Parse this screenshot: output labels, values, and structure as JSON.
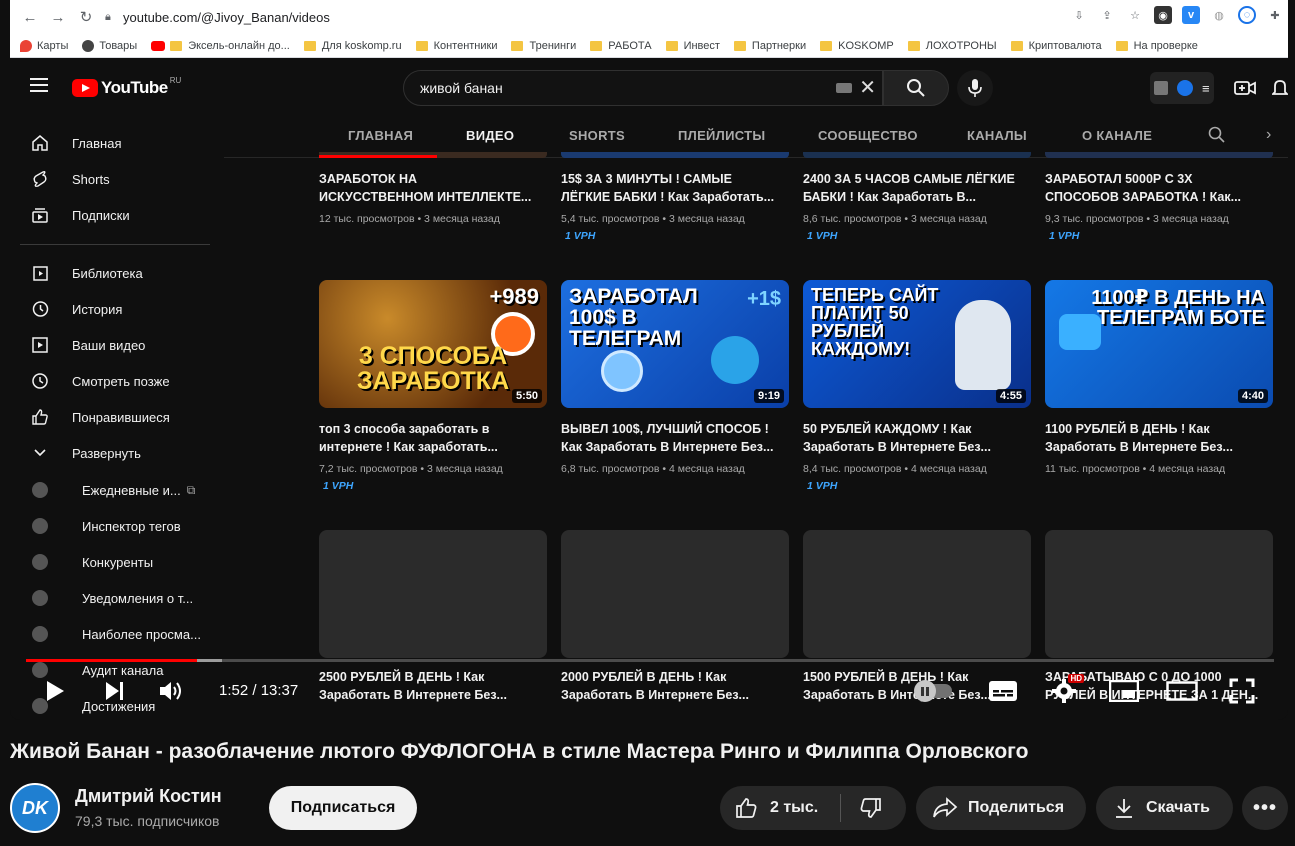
{
  "browser": {
    "url": "youtube.com/@Jivoy_Banan/videos",
    "bookmarks": [
      "Карты",
      "Товары",
      "Эксель-онлайн до...",
      "Для koskomp.ru",
      "Контентники",
      "Тренинги",
      "РАБОТА",
      "Инвест",
      "Партнерки",
      "KOSKOMP",
      "ЛОХОТРОНЫ",
      "Криптовалюта",
      "На проверке"
    ]
  },
  "yt_inner": {
    "logo_text": "YouTube",
    "logo_region": "RU",
    "search_query": "живой банан",
    "tabs": [
      "ГЛАВНАЯ",
      "ВИДЕО",
      "SHORTS",
      "ПЛЕЙЛИСТЫ",
      "СООБЩЕСТВО",
      "КАНАЛЫ",
      "О КАНАЛЕ"
    ],
    "active_tab": "ВИДЕО",
    "sidebar": {
      "main": [
        "Главная",
        "Shorts",
        "Подписки"
      ],
      "library": [
        "Библиотека",
        "История",
        "Ваши видео",
        "Смотреть позже",
        "Понравившиеся",
        "Развернуть"
      ],
      "extensions": [
        "Ежедневные и...",
        "Инспектор тегов",
        "Конкуренты",
        "Уведомления о т...",
        "Наиболее просма...",
        "Аудит канала",
        "Достижения"
      ]
    },
    "row1": [
      {
        "title1": "ЗАРАБОТОК НА",
        "title2": "ИСКУССТВЕННОМ ИНТЕЛЛЕКТЕ...",
        "meta": "12 тыс. просмотров • 3 месяца назад",
        "vph": ""
      },
      {
        "title1": "15$ ЗА 3 МИНУТЫ ! САМЫЕ",
        "title2": "ЛЁГКИЕ БАБКИ ! Как Заработать...",
        "meta": "5,4 тыс. просмотров • 3 месяца назад",
        "vph": "1 VPH"
      },
      {
        "title1": "2400 ЗА 5 ЧАСОВ САМЫЕ ЛЁГКИЕ",
        "title2": "БАБКИ ! Как Заработать В...",
        "meta": "8,6 тыс. просмотров • 3 месяца назад",
        "vph": "1 VPH"
      },
      {
        "title1": "ЗАРАБОТАЛ 5000Р С 3Х",
        "title2": "СПОСОБОВ ЗАРАБОТКА ! Как...",
        "meta": "9,3 тыс. просмотров • 3 месяца назад",
        "vph": "1 VPH"
      }
    ],
    "row2": [
      {
        "thumb": "3 СПОСОБА ЗАРАБОТКА",
        "thumb_badge": "+989",
        "duration": "5:50",
        "title1": "топ 3 способа заработать в",
        "title2": "интернете ! Как заработать...",
        "meta": "7,2 тыс. просмотров • 3 месяца назад",
        "vph": "1 VPH"
      },
      {
        "thumb": "ЗАРАБОТАЛ 100$ В ТЕЛЕГРАМ",
        "thumb_badge": "+1$",
        "duration": "9:19",
        "title1": "ВЫВЕЛ 100$, ЛУЧШИЙ СПОСОБ !",
        "title2": "Как Заработать В Интернете Без...",
        "meta": "6,8 тыс. просмотров • 4 месяца назад",
        "vph": ""
      },
      {
        "thumb": "ТЕПЕРЬ САЙТ ПЛАТИТ 50 РУБЛЕЙ КАЖДОМУ!",
        "thumb_badge": "",
        "duration": "4:55",
        "title1": "50 РУБЛЕЙ КАЖДОМУ ! Как",
        "title2": "Заработать В Интернете Без...",
        "meta": "8,4 тыс. просмотров • 4 месяца назад",
        "vph": "1 VPH"
      },
      {
        "thumb": "1100₽ В ДЕНЬ НА ТЕЛЕГРАМ БОТЕ",
        "thumb_badge": "",
        "duration": "4:40",
        "title1": "1100 РУБЛЕЙ В ДЕНЬ ! Как",
        "title2": "Заработать В Интернете Без...",
        "meta": "11 тыс. просмотров • 4 месяца назад",
        "vph": ""
      }
    ],
    "row3": [
      {
        "title1": "2500 РУБЛЕЙ В ДЕНЬ ! Как",
        "title2": "Заработать В Интернете Без..."
      },
      {
        "title1": "2000 РУБЛЕЙ В ДЕНЬ ! Как",
        "title2": "Заработать В Интернете Без..."
      },
      {
        "title1": "1500 РУБЛЕЙ В ДЕНЬ ! Как",
        "title2": "Заработать В Интернете Без..."
      },
      {
        "title1": "ЗАРАБАТЫВАЮ С 0 ДО 1000",
        "title2": "РУБЛЕЙ В ИНТЕРНЕТЕ ЗА 1 ДЕН..."
      }
    ]
  },
  "player": {
    "time": "1:52 / 13:37",
    "played_fraction": 0.137,
    "buffered_fraction": 0.157,
    "hd_badge": "HD"
  },
  "video": {
    "title": "Живой Банан - разоблачение лютого ФУФЛОГОНА в стиле Мастера Ринго и Филиппа Орловского",
    "channel": "Дмитрий Костин",
    "subscribers": "79,3 тыс. подписчиков",
    "avatar_text": "DK",
    "subscribe_label": "Подписаться",
    "likes": "2 тыс.",
    "share_label": "Поделиться",
    "download_label": "Скачать",
    "more_label": "•••"
  },
  "colors": {
    "accent_red": "#ff0000",
    "vph_blue": "#3ea6ff",
    "background": "#0f0f0f"
  }
}
